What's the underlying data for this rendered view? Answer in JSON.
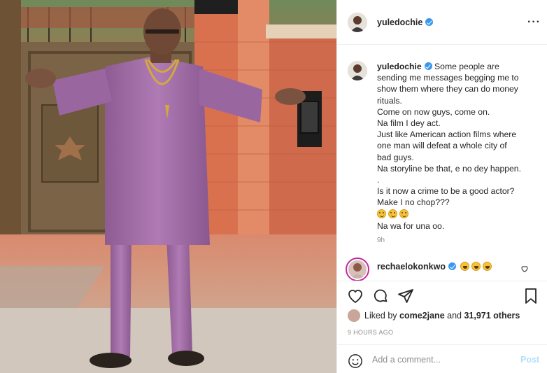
{
  "post": {
    "username": "yuledochie",
    "verified": true,
    "more_icon": "ellipsis-icon"
  },
  "caption": {
    "username": "yuledochie",
    "lines": [
      " Some people are",
      "sending me messages begging me to",
      "show them where they can do money",
      "rituals.",
      "Come on now guys, come on.",
      "Na film I dey act.",
      "Just like American action films where",
      "one man will defeat a whole city of",
      "bad guys.",
      "Na storyline be that, e no dey happen.",
      ".",
      "Is it now a crime to be a good actor?",
      "Make I no chop???"
    ],
    "emoji_line": [
      "grinning-face-emoji",
      "grinning-face-emoji",
      "grinning-face-emoji"
    ],
    "last_line": "Na wa for una oo.",
    "time_ago": "9h"
  },
  "comment": {
    "username": "rechaelokonkwo",
    "verified": true,
    "emojis": [
      "laughing-face-emoji",
      "laughing-face-emoji",
      "laughing-face-emoji"
    ]
  },
  "likes": {
    "prefix": "Liked by ",
    "liker": "come2jane",
    "middle": " and ",
    "count": "31,971 others"
  },
  "post_time": "9 HOURS AGO",
  "comment_box": {
    "placeholder": "Add a comment...",
    "post_label": "Post"
  },
  "colors": {
    "verified": "#3897f0",
    "post_button_disabled": "#b2dffc",
    "outfit": "#a26aa6"
  }
}
